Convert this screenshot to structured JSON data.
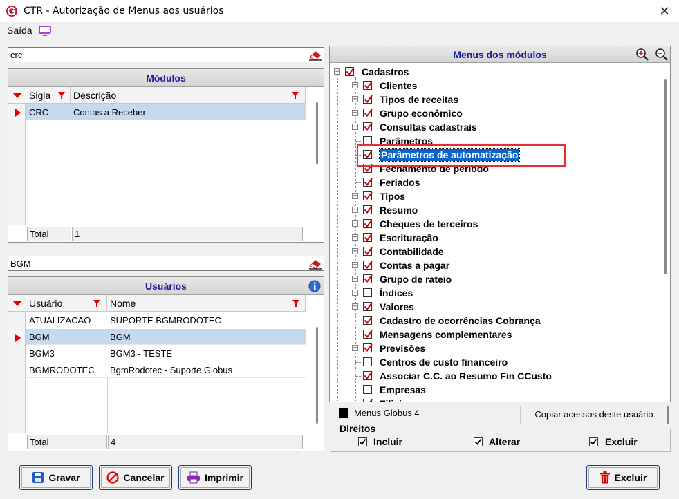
{
  "window": {
    "title": "CTR - Autorização de Menus aos usuários",
    "close_glyph": "✕"
  },
  "toolbar": {
    "saida_label": "Saída"
  },
  "modulos": {
    "search_value": "crc",
    "title": "Módulos",
    "col_sigla": "Sigla",
    "col_descricao": "Descrição",
    "rows": [
      {
        "sigla": "CRC",
        "descricao": "Contas a Receber"
      }
    ],
    "total_label": "Total",
    "total_value": "1"
  },
  "usuarios": {
    "search_value": "BGM",
    "title": "Usuários",
    "col_usuario": "Usuário",
    "col_nome": "Nome",
    "rows": [
      {
        "usuario": "ATUALIZACAO",
        "nome": "SUPORTE BGMRODOTEC"
      },
      {
        "usuario": "BGM",
        "nome": "BGM"
      },
      {
        "usuario": "BGM3",
        "nome": "BGM3 - TESTE"
      },
      {
        "usuario": "BGMRODOTEC",
        "nome": "BgmRodotec - Suporte Globus"
      }
    ],
    "total_label": "Total",
    "total_value": "4"
  },
  "menus": {
    "title": "Menus dos módulos",
    "root": "Cadastros",
    "items": [
      "Clientes",
      "Tipos de receitas",
      "Grupo econômico",
      "Consultas cadastrais",
      "Parâmetros",
      "Parâmetros de automatização",
      "Fechamento de período",
      "Feriados",
      "Tipos",
      "Resumo",
      "Cheques de terceiros",
      "Escrituração",
      "Contabilidade",
      "Contas a pagar",
      "Grupo de rateio",
      "Índices",
      "Valores",
      "Cadastro de ocorrências Cobrança",
      "Mensagens complementares",
      "Previsões",
      "Centros de custo financeiro",
      "Associar C.C. ao Resumo Fin CCusto",
      "Empresas",
      "Filiais"
    ],
    "legend_label": "Menus Globus 4",
    "copy_button": "Copiar acessos deste usuário"
  },
  "direitos": {
    "title": "Direitos",
    "incluir": "Incluir",
    "alterar": "Alterar",
    "excluir": "Excluir"
  },
  "buttons": {
    "gravar": "Gravar",
    "cancelar": "Cancelar",
    "imprimir": "Imprimir",
    "excluir": "Excluir"
  },
  "colors": {
    "header_text": "#1a1a9a",
    "selection": "#c5d9f1",
    "check_red": "#d40000",
    "highlight_box": "#e0303a"
  },
  "icons": [
    "app-logo-icon",
    "close-icon",
    "monitor-icon",
    "eraser-icon",
    "filter-icon",
    "info-icon",
    "zoom-in-icon",
    "zoom-out-icon",
    "save-icon",
    "cancel-icon",
    "print-icon",
    "trash-icon"
  ]
}
